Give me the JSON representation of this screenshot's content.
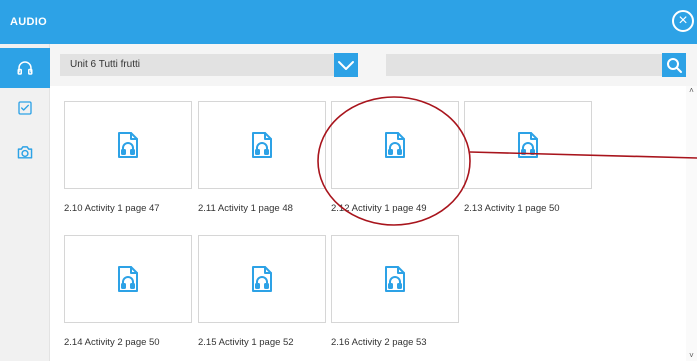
{
  "window": {
    "title": "AUDIO",
    "close_icon": "close-circle-icon"
  },
  "sidebar": {
    "items": [
      {
        "icon": "headphones-icon",
        "active": true
      },
      {
        "icon": "checkbox-icon",
        "active": false
      },
      {
        "icon": "camera-icon",
        "active": false
      }
    ]
  },
  "toolbar": {
    "unit_select_value": "Unit 6 Tutti frutti",
    "dropdown_icon": "chevron-down-icon",
    "search_placeholder": "",
    "search_icon": "search-icon"
  },
  "tracks": [
    {
      "label": "2.10 Activity 1 page 47"
    },
    {
      "label": "2.11 Activity 1 page 48"
    },
    {
      "label": "2.12 Activity 1 page 49"
    },
    {
      "label": "2.13 Activity 1 page 50"
    },
    {
      "label": "2.14 Activity 2 page 50"
    },
    {
      "label": "2.15 Activity 1 page 52"
    },
    {
      "label": "2.16 Activity 2 page 53"
    }
  ],
  "colors": {
    "accent": "#2da2e6",
    "annotation": "#a8141c"
  }
}
